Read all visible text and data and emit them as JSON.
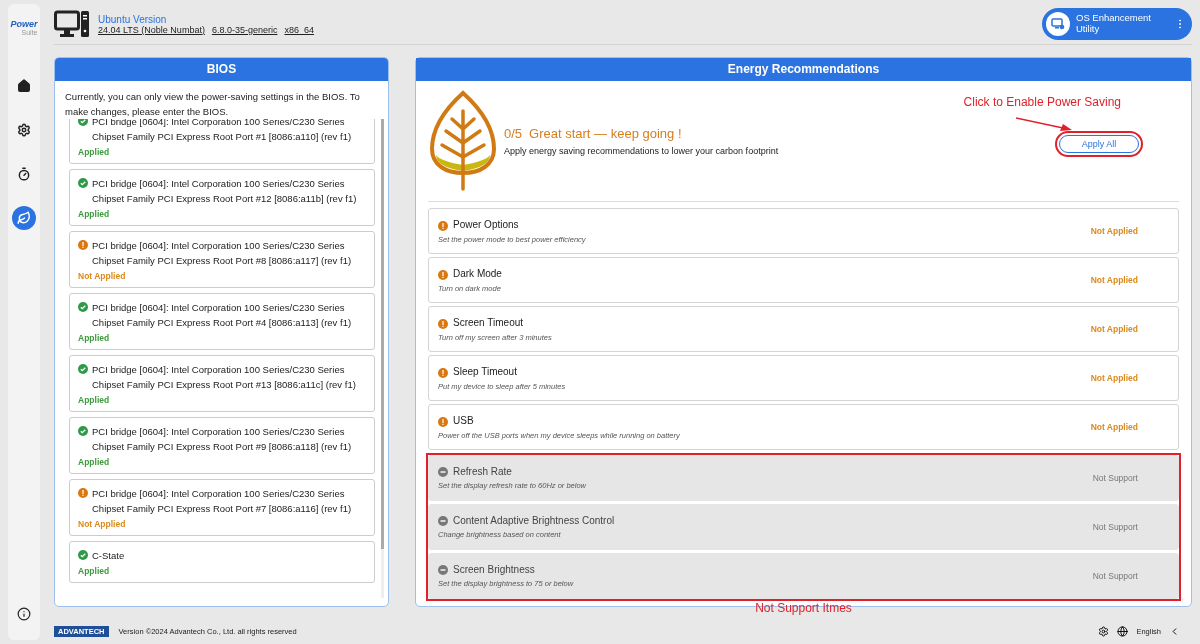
{
  "logo": {
    "brand": "Power",
    "sub": "Suite"
  },
  "sidebar": {
    "items": [
      {
        "kind": "home",
        "selected": false
      },
      {
        "kind": "settings",
        "selected": false
      },
      {
        "kind": "timer",
        "selected": false
      },
      {
        "kind": "leaf",
        "selected": true
      }
    ]
  },
  "header": {
    "title": "Ubuntu Version",
    "details": [
      "24.04 LTS (Noble Numbat)",
      "6.8.0-35-generic",
      "x86_64"
    ],
    "utility_button": "OS Enhancement Utility"
  },
  "bios": {
    "title": "BIOS",
    "notice": "Currently, you can only view the power-saving settings in the BIOS. To make changes, please enter the BIOS.",
    "items": [
      {
        "name": "PCI bridge [0604]: Intel Corporation 100 Series/C230 Series Chipset Family PCI Express Root Port #1 [8086:a110] (rev f1)",
        "applied": true,
        "status": "Applied"
      },
      {
        "name": "PCI bridge [0604]: Intel Corporation 100 Series/C230 Series Chipset Family PCI Express Root Port #12 [8086:a11b] (rev f1)",
        "applied": true,
        "status": "Applied"
      },
      {
        "name": "PCI bridge [0604]: Intel Corporation 100 Series/C230 Series Chipset Family PCI Express Root Port #8 [8086:a117] (rev f1)",
        "applied": false,
        "status": "Not Applied"
      },
      {
        "name": "PCI bridge [0604]: Intel Corporation 100 Series/C230 Series Chipset Family PCI Express Root Port #4 [8086:a113] (rev f1)",
        "applied": true,
        "status": "Applied"
      },
      {
        "name": "PCI bridge [0604]: Intel Corporation 100 Series/C230 Series Chipset Family PCI Express Root Port #13 [8086:a11c] (rev f1)",
        "applied": true,
        "status": "Applied"
      },
      {
        "name": "PCI bridge [0604]: Intel Corporation 100 Series/C230 Series Chipset Family PCI Express Root Port #9 [8086:a118] (rev f1)",
        "applied": true,
        "status": "Applied"
      },
      {
        "name": "PCI bridge [0604]: Intel Corporation 100 Series/C230 Series Chipset Family PCI Express Root Port #7 [8086:a116] (rev f1)",
        "applied": false,
        "status": "Not Applied"
      },
      {
        "name": "C-State",
        "applied": true,
        "status": "Applied"
      }
    ]
  },
  "energy": {
    "title": "Energy Recommendations",
    "progress": "0/5",
    "headline": "Great start — keep going !",
    "subtitle": "Apply energy saving recommendations to lower your carbon footprint",
    "apply_button": "Apply All",
    "items": [
      {
        "title": "Power Options",
        "description": "Set the power mode to best power efficiency",
        "kind": "recommendation",
        "applied": false,
        "status": "Not Applied"
      },
      {
        "title": "Dark Mode",
        "description": "Turn on dark mode",
        "kind": "recommendation",
        "applied": false,
        "status": "Not Applied"
      },
      {
        "title": "Screen Timeout",
        "description": "Turn off my screen after 3 minutes",
        "kind": "recommendation",
        "applied": false,
        "status": "Not Applied"
      },
      {
        "title": "Sleep Timeout",
        "description": "Put my device to sleep after 5 minutes",
        "kind": "recommendation",
        "applied": false,
        "status": "Not Applied"
      },
      {
        "title": "USB",
        "description": "Power off the USB ports when my device sleeps while running on battery",
        "kind": "recommendation",
        "applied": false,
        "status": "Not Applied"
      },
      {
        "title": "Refresh Rate",
        "description": "Set the display refresh rate to 60Hz or below",
        "kind": "unsupported",
        "status": "Not Support"
      },
      {
        "title": "Content Adaptive Brightness Control",
        "description": "Change brightness based on content",
        "kind": "unsupported",
        "status": "Not Support"
      },
      {
        "title": "Screen Brightness",
        "description": "Set the display brightness to 75 or below",
        "kind": "unsupported",
        "status": "Not Support"
      }
    ]
  },
  "annotations": {
    "callout": "Click to Enable Power Saving",
    "frame_note": "Not Support Itmes"
  },
  "footer": {
    "brand": "ADVANTECH",
    "copyright": "Version ©2024 Advantech Co., Ltd. all rights reserved",
    "language": "English"
  }
}
